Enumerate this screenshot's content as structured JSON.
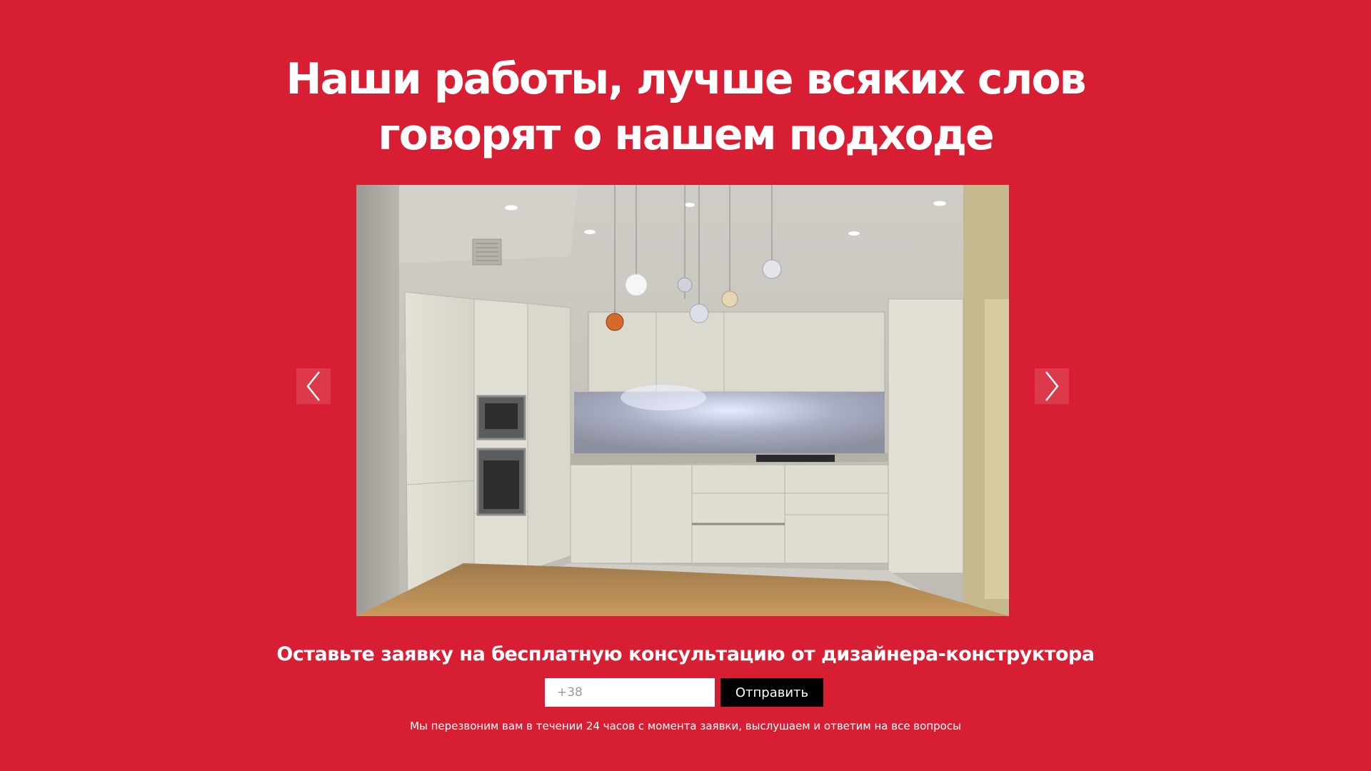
{
  "page": {
    "background_color": "#d81e32",
    "headline_lines": [
      "Наши работы, лучше всяких слов",
      "говорят о нашем подходе"
    ]
  },
  "gallery": {
    "prev_icon": "chevron-left-icon",
    "next_icon": "chevron-right-icon",
    "image_subject": "kitchen-photo"
  },
  "cta": {
    "title": "Оставьте заявку на бесплатную консультацию от дизайнера-конструктора",
    "phone_placeholder": "+38",
    "submit_label": "Отправить",
    "button_color": "#000000",
    "note": "Мы перезвоним вам в течении 24 часов с момента заявки, выслушаем и ответим на все вопросы"
  }
}
